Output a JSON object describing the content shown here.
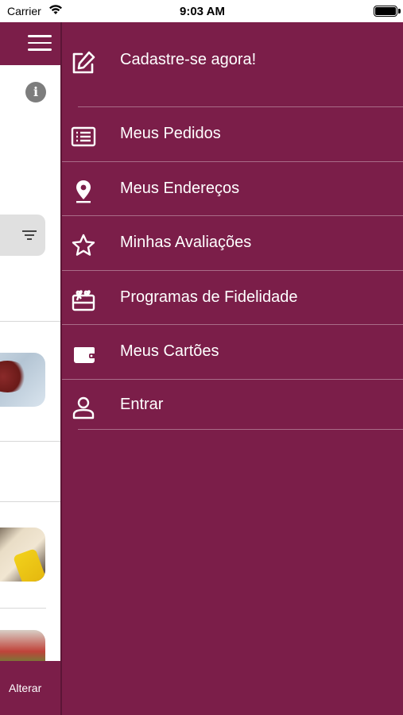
{
  "status_bar": {
    "carrier": "Carrier",
    "time": "9:03 AM"
  },
  "background_app": {
    "bottom_action_label": "Alterar"
  },
  "drawer": {
    "items": [
      {
        "label": "Cadastre-se agora!",
        "icon": "edit-icon"
      },
      {
        "label": "Meus Pedidos",
        "icon": "list-icon"
      },
      {
        "label": "Meus Endereços",
        "icon": "location-pin-icon"
      },
      {
        "label": "Minhas Avaliações",
        "icon": "star-icon"
      },
      {
        "label": "Programas de Fidelidade",
        "icon": "gift-card-icon"
      },
      {
        "label": "Meus Cartões",
        "icon": "wallet-icon"
      },
      {
        "label": "Entrar",
        "icon": "user-icon"
      }
    ]
  },
  "colors": {
    "brand": "#7b1e49",
    "text_on_brand": "#ffffff"
  }
}
